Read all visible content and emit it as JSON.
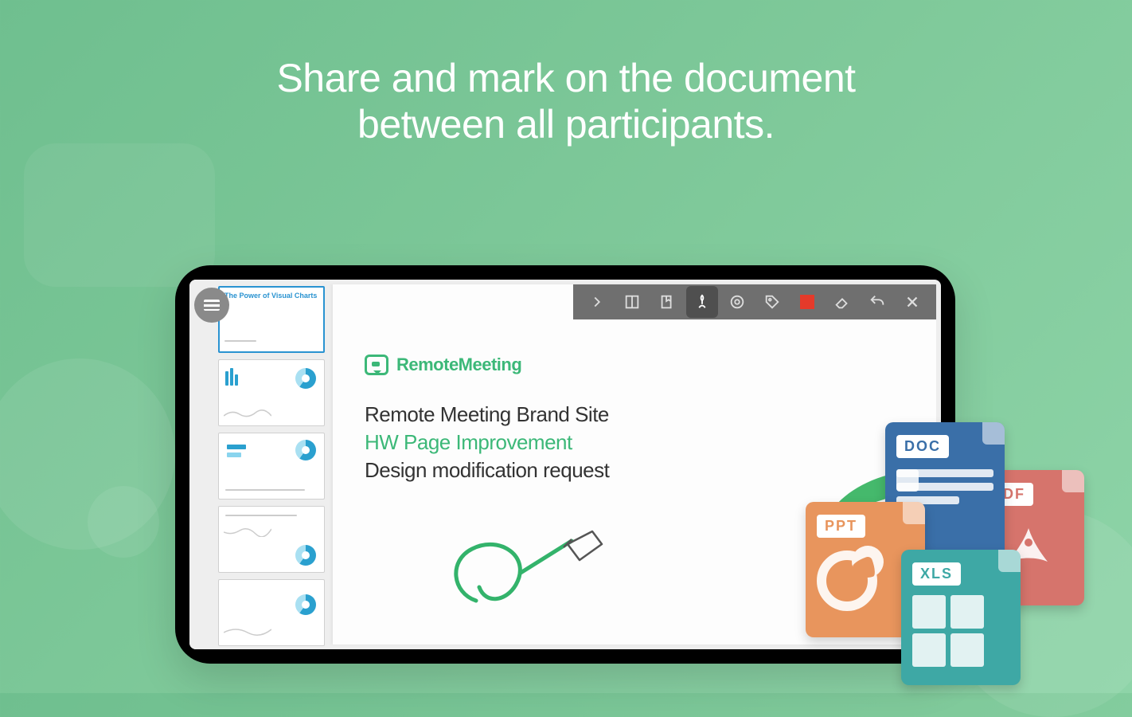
{
  "hero": {
    "line1": "Share and mark on the document",
    "line2": "between all participants."
  },
  "app": {
    "brand": "RemoteMeeting"
  },
  "document": {
    "line1": "Remote Meeting Brand Site",
    "line2": "HW Page Improvement",
    "line3": "Design modification request"
  },
  "thumbs": [
    {
      "title": "The Power of Visual Charts"
    },
    {
      "title": ""
    },
    {
      "title": ""
    },
    {
      "title": ""
    },
    {
      "title": ""
    }
  ],
  "toolbar_icons": {
    "next": "next-icon",
    "layout": "layout-icon",
    "bookmark": "bookmark-icon",
    "draw": "draw-icon",
    "target": "target-icon",
    "tag": "tag-icon",
    "color": "#e43a2a",
    "eraser": "eraser-icon",
    "undo": "undo-icon",
    "close": "close-icon"
  },
  "files": {
    "doc": "DOC",
    "ppt": "PPT",
    "pdf": "PDF",
    "xls": "XLS"
  }
}
